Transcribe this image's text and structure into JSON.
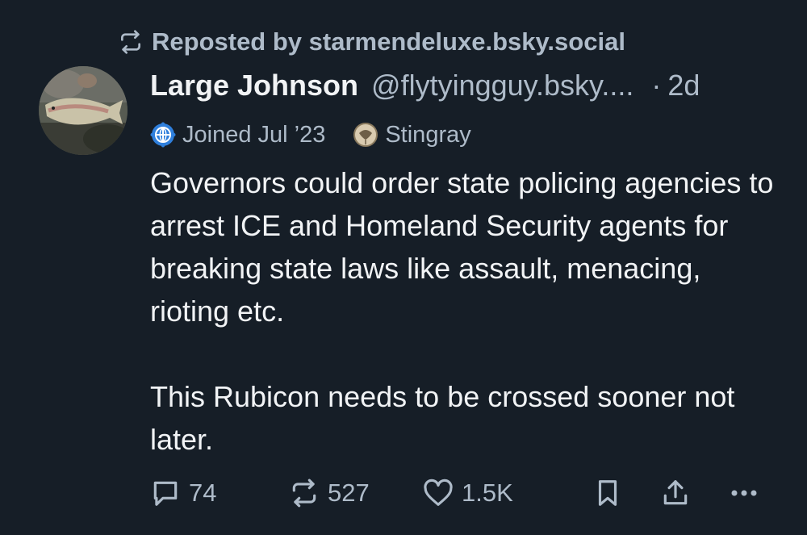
{
  "repost": {
    "label": "Reposted by starmendeluxe.bsky.social",
    "icon": "repost-icon"
  },
  "author": {
    "display_name": "Large Johnson",
    "handle": "@flytyingguy.bsky....",
    "separator": "·",
    "time": "2d",
    "avatar": "avatar-fish-photo"
  },
  "badges": [
    {
      "icon": "globe-badge-icon",
      "label": "Joined Jul ’23"
    },
    {
      "icon": "stingray-badge-icon",
      "label": "Stingray"
    }
  ],
  "post": {
    "paragraphs": [
      "Governors could order state policing agencies to arrest ICE and Homeland Security agents for breaking state laws like assault, menacing, rioting etc.",
      "This Rubicon needs to be crossed sooner not later."
    ]
  },
  "actions": {
    "reply_count": "74",
    "repost_count": "527",
    "like_count": "1.5K"
  },
  "colors": {
    "background": "#161e27",
    "text": "#f1f3f5",
    "muted": "#aebbc9",
    "badge_blue": "#2f7fdc"
  }
}
